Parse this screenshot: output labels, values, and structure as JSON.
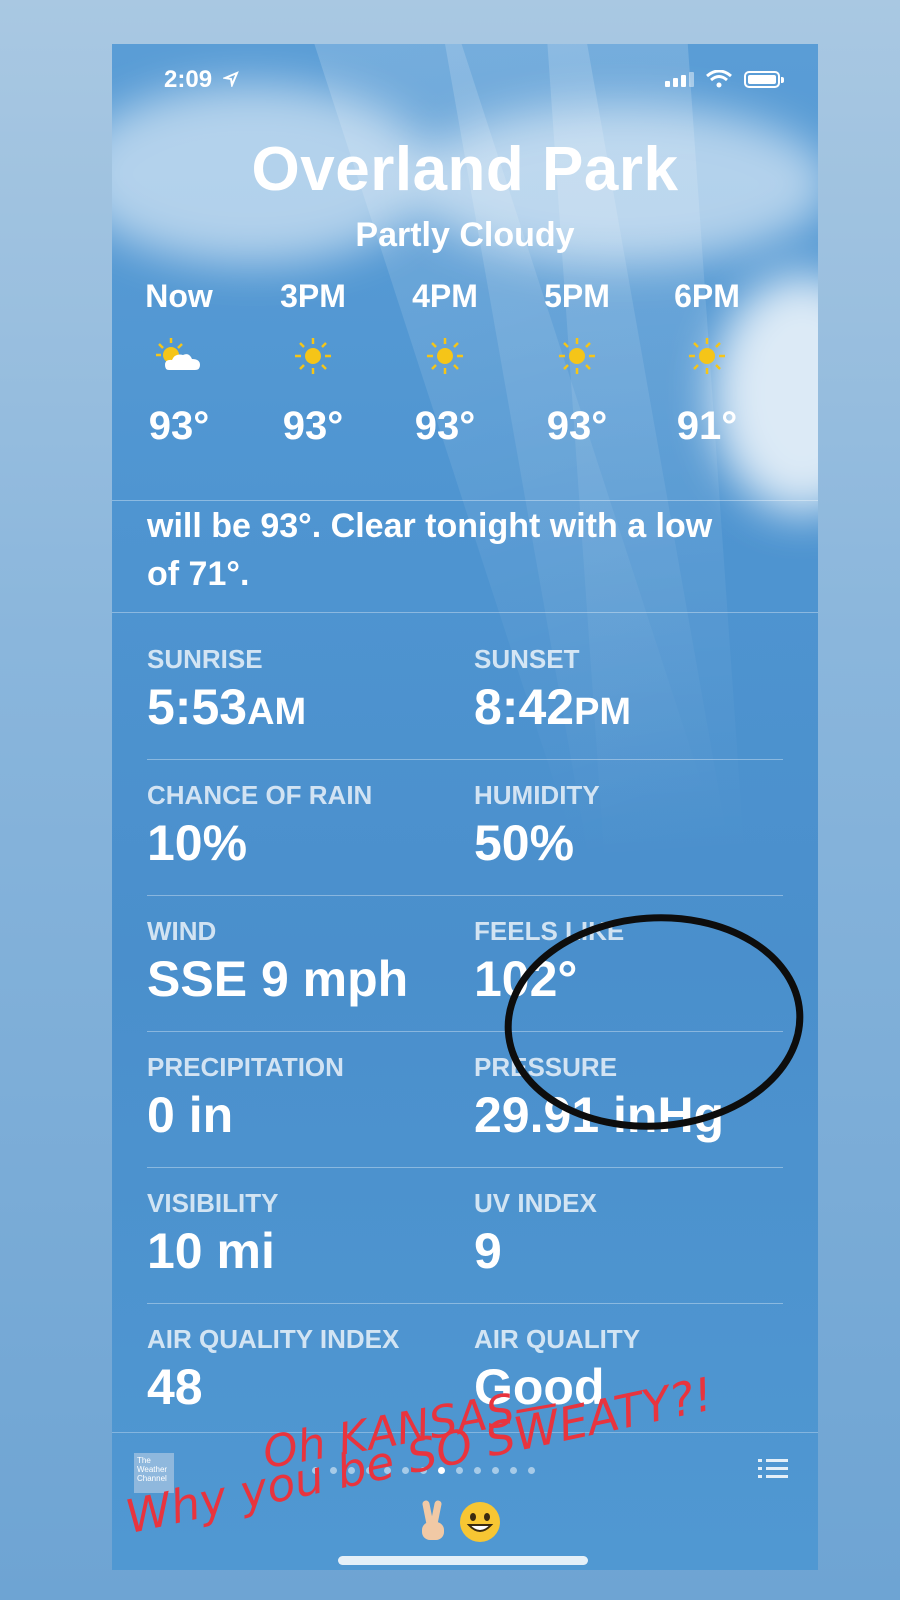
{
  "status_bar": {
    "time": "2:09"
  },
  "location": {
    "city": "Overland Park",
    "condition": "Partly Cloudy"
  },
  "hourly": [
    {
      "label": "Now",
      "icon": "partly-cloudy-icon",
      "temp": "93°"
    },
    {
      "label": "3PM",
      "icon": "sun-icon",
      "temp": "93°"
    },
    {
      "label": "4PM",
      "icon": "sun-icon",
      "temp": "93°"
    },
    {
      "label": "5PM",
      "icon": "sun-icon",
      "temp": "93°"
    },
    {
      "label": "6PM",
      "icon": "sun-icon",
      "temp": "91°"
    }
  ],
  "summary": {
    "line1": "will be 93°. Clear tonight with a low",
    "line2": "of 71°."
  },
  "details": [
    {
      "left_key": "SUNRISE",
      "left_val": "5:53",
      "left_suffix": "AM",
      "right_key": "SUNSET",
      "right_val": "8:42",
      "right_suffix": "PM"
    },
    {
      "left_key": "CHANCE OF RAIN",
      "left_val": "10%",
      "left_suffix": "",
      "right_key": "HUMIDITY",
      "right_val": "50%",
      "right_suffix": ""
    },
    {
      "left_key": "WIND",
      "left_val": "SSE 9 mph",
      "left_suffix": "",
      "right_key": "FEELS LIKE",
      "right_val": "102°",
      "right_suffix": ""
    },
    {
      "left_key": "PRECIPITATION",
      "left_val": "0 in",
      "left_suffix": "",
      "right_key": "PRESSURE",
      "right_val": "29.91 inHg",
      "right_suffix": ""
    },
    {
      "left_key": "VISIBILITY",
      "left_val": "10 mi",
      "left_suffix": "",
      "right_key": "UV INDEX",
      "right_val": "9",
      "right_suffix": ""
    },
    {
      "left_key": "AIR QUALITY INDEX",
      "left_val": "48",
      "left_suffix": "",
      "right_key": "AIR QUALITY",
      "right_val": "Good",
      "right_suffix": ""
    }
  ],
  "footer": {
    "logo_text": "The Weather Channel"
  },
  "annotation": {
    "line1": "Oh KANSAS—",
    "line2": "Why you be SO SWEATY?!",
    "color": "#e8343e"
  },
  "colors": {
    "sky_top": "#5a9dd6",
    "sky_bottom": "#5098d2",
    "sun": "#f5c518"
  }
}
